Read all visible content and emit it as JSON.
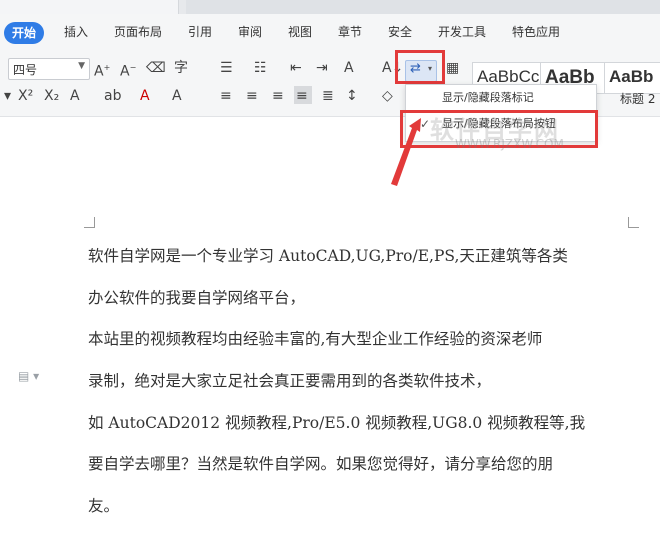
{
  "menu": {
    "start": "开始",
    "items": [
      "插入",
      "页面布局",
      "引用",
      "审阅",
      "视图",
      "章节",
      "安全",
      "开发工具",
      "特色应用"
    ]
  },
  "toolbar": {
    "font_size": "四号",
    "styles": [
      "AaBbCcDd",
      "AaBb",
      "AaBb"
    ],
    "heading2": "标题 2"
  },
  "dropdown": {
    "item1": "显示/隐藏段落标记",
    "item2": "显示/隐藏段落布局按钮",
    "checked_item": 2
  },
  "document": {
    "lines": [
      "软件自学网是一个专业学习 AutoCAD,UG,Pro/E,PS,天正建筑等各类",
      "办公软件的我要自学网络平台，",
      "本站里的视频教程均由经验丰富的,有大型企业工作经验的资深老师",
      "录制，绝对是大家立足社会真正要需用到的各类软件技术，",
      "如 AutoCAD2012 视频教程,Pro/E5.0 视频教程,UG8.0 视频教程等,我",
      "要自学去哪里？当然是软件自学网。如果您觉得好，请分享给您的朋",
      "友。"
    ]
  },
  "watermark": {
    "line1": "软件自学网",
    "line2": "WWW.RJZXW.COM"
  },
  "colors": {
    "accent": "#2f7ce6",
    "highlight_red": "#e23a3a"
  }
}
